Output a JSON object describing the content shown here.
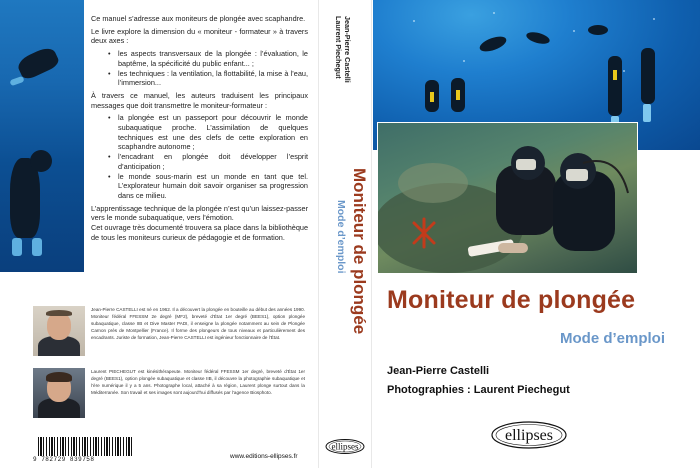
{
  "back_cover": {
    "paragraphs": [
      "Ce manuel s’adresse aux moniteurs de plongée avec scaphandre.",
      "Le livre explore la dimension du « moniteur - formateur » à travers deux axes :"
    ],
    "axes": [
      "les aspects transversaux de la plongée : l’évaluation, le baptême, la spécificité du public enfant... ;",
      "les techniques : la ventilation, la flottabilité, la mise à l’eau, l’immersion..."
    ],
    "paragraph_messages": "À travers ce manuel, les auteurs traduisent les principaux messages que doit transmettre le moniteur-formateur :",
    "messages": [
      "la plongée est un passeport pour découvrir le monde subaquatique proche. L’assimilation de quelques techniques est une des clefs de cette exploration en scaphandre autonome ;",
      "l’encadrant en plongée doit développer l’esprit d’anticipation ;",
      "le monde sous-marin est un monde en tant que tel. L’explorateur humain doit savoir organiser sa progression dans ce milieu."
    ],
    "closing_1": "L’apprentissage technique de la plongée n’est qu’un laissez-passer vers le monde subaquatique, vers l’émotion.",
    "closing_2": "Cet ouvrage très documenté trouvera sa place dans la bibliothèque de tous les moniteurs curieux de pédagogie et de formation.",
    "author_1_bio": "Jean-Pierre CASTELLI est né en 1962. Il a découvert la plongée en bouteille au début des années 1990. Moniteur fédéral FFESSM 2e degré (MF2), breveté d’État 1er degré (BEES1), option plongée subaquatique, classe IIB et Dive Master PADI, il enseigne la plongée notamment au sein de Plongée Carnon près de Montpellier (France). Il forme des plongeurs de tous niveaux et particulièrement des encadrants. Juriste de formation, Jean-Pierre CASTELLI est ingénieur fonctionnaire de l’État.",
    "author_2_bio": "Laurent PIECHEGUT est kinésithérapeute. Moniteur fédéral FFESSM 1er degré, breveté d’État 1er degré (BEES1), option plongée subaquatique et classe IIB, il découvre la photographie subaquatique et l’ère numérique il y a 5 ans. Photographe local, attaché à sa région, Laurent plonge surtout dans la Méditerranée. Son travail et ses images sont aujourd’hui diffusés par l’agence Biosphoto.",
    "barcode_number": "9 782729 839758",
    "website": "www.editions-ellipses.fr"
  },
  "spine": {
    "authors_line_1": "Jean-Pierre Castelli",
    "authors_line_2": "Laurent Piechegut",
    "title": "Moniteur de plongée",
    "subtitle": "Mode d’emploi",
    "publisher": "ellipses"
  },
  "front_cover": {
    "title": "Moniteur de plongée",
    "subtitle": "Mode d’emploi",
    "author": "Jean-Pierre Castelli",
    "photographer": "Photographies : Laurent Piechegut",
    "publisher": "ellipses"
  },
  "colors": {
    "title": "#9b3a1e",
    "subtitle": "#6a97c9",
    "water": "#1f7fcf"
  }
}
